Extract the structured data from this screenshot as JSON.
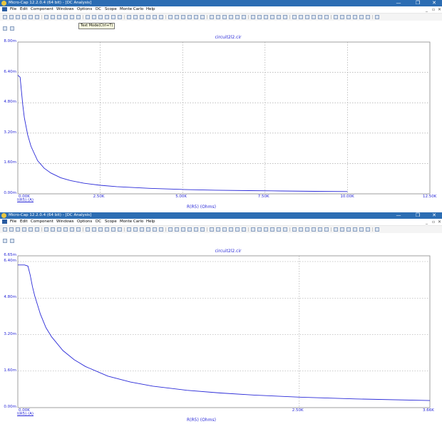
{
  "windows": [
    {
      "titlebar": {
        "title": "Micro-Cap 12.2.0.4 (64 bit) - [DC Analysis]",
        "minimize": "—",
        "maximize": "❐",
        "close": "✕"
      },
      "menu": [
        "File",
        "Edit",
        "Component",
        "Windows",
        "Options",
        "DC",
        "Scope",
        "Monte Carlo",
        "Help"
      ],
      "mdi_controls": {
        "minimize": "_",
        "restore": "▫",
        "close": "✕"
      },
      "tooltip": "Text Mode(Ctrl+T)",
      "chart_data": {
        "type": "line",
        "title": "circuit2l2.cir",
        "xlabel": "R(R5) (Ohms)",
        "ylabel": "",
        "xlim": [
          0,
          12500
        ],
        "ylim": [
          0,
          0.008
        ],
        "x_ticks": [
          "0.00K",
          "2.50K",
          "5.00K",
          "7.50K",
          "10.00K",
          "12.50K"
        ],
        "y_ticks": [
          "0.00m",
          "1.60m",
          "3.20m",
          "4.80m",
          "6.40m",
          "8.00m"
        ],
        "grid": true,
        "series": [
          {
            "name": "I(R5) (A)",
            "color": "#2a2ad8",
            "x": [
              0,
              70,
              110,
              150,
              200,
              300,
              400,
              600,
              800,
              1000,
              1300,
              1600,
              2000,
              2500,
              3000,
              4000,
              5000,
              6000,
              7000,
              8000,
              9000,
              10000
            ],
            "y": [
              0.00625,
              0.00615,
              0.0054,
              0.0047,
              0.004,
              0.0031,
              0.0025,
              0.00175,
              0.00135,
              0.0011,
              0.00085,
              0.0007,
              0.00056,
              0.00045,
              0.00038,
              0.00029,
              0.00023,
              0.00019,
              0.00017,
              0.00015,
              0.00013,
              0.00012
            ]
          }
        ]
      }
    },
    {
      "titlebar": {
        "title": "Micro-Cap 12.2.0.4 (64 bit) - [DC Analysis]",
        "minimize": "—",
        "maximize": "❐",
        "close": "✕"
      },
      "menu": [
        "File",
        "Edit",
        "Component",
        "Windows",
        "Options",
        "DC",
        "Scope",
        "Monte Carlo",
        "Help"
      ],
      "mdi_controls": {
        "minimize": "_",
        "restore": "▫",
        "close": "✕"
      },
      "chart_data": {
        "type": "line",
        "title": "circuit2l2.cir",
        "xlabel": "R(R5) (Ohms)",
        "ylabel": "",
        "xlim": [
          0,
          3660
        ],
        "ylim": [
          0,
          0.00665
        ],
        "x_ticks": [
          "0.00K",
          "2.50K",
          "3.66K"
        ],
        "y_ticks": [
          "0.00m",
          "1.60m",
          "3.20m",
          "4.80m",
          "6.40m",
          "6.65m"
        ],
        "grid": true,
        "series": [
          {
            "name": "I(R5) (A)",
            "color": "#2a2ad8",
            "x": [
              0,
              60,
              90,
              110,
              130,
              150,
              200,
              250,
              300,
              400,
              500,
              600,
              800,
              1000,
              1200,
              1500,
              1800,
              2100,
              2500,
              3000,
              3660
            ],
            "y": [
              0.00625,
              0.00625,
              0.0062,
              0.0058,
              0.0053,
              0.0049,
              0.0041,
              0.0035,
              0.0031,
              0.0025,
              0.0021,
              0.0018,
              0.00138,
              0.00112,
              0.00094,
              0.00076,
              0.00064,
              0.00055,
              0.00046,
              0.00038,
              0.00031
            ]
          }
        ]
      }
    }
  ]
}
